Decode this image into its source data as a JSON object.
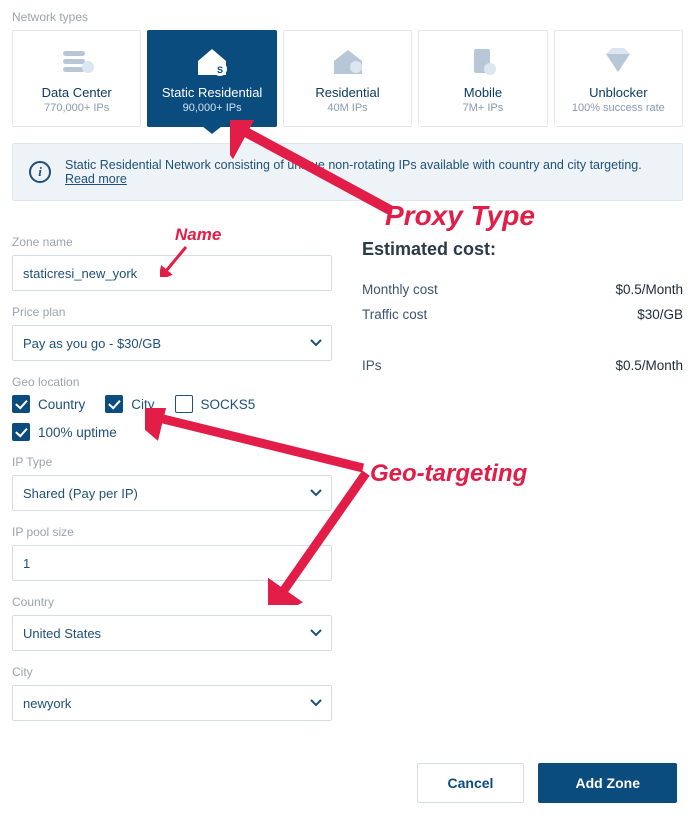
{
  "section_label": "Network types",
  "types": [
    {
      "title": "Data Center",
      "sub": "770,000+ IPs"
    },
    {
      "title": "Static Residential",
      "sub": "90,000+ IPs"
    },
    {
      "title": "Residential",
      "sub": "40M IPs"
    },
    {
      "title": "Mobile",
      "sub": "7M+ IPs"
    },
    {
      "title": "Unblocker",
      "sub": "100% success rate"
    }
  ],
  "info_text": "Static Residential Network consisting of unique non-rotating IPs available with country and city targeting.",
  "read_more": "Read more",
  "form": {
    "zone_name_label": "Zone name",
    "zone_name_value": "staticresi_new_york",
    "price_label": "Price plan",
    "price_value": "Pay as you go - $30/GB",
    "geo_label": "Geo location",
    "country_cb": "Country",
    "city_cb": "City",
    "socks5_cb": "SOCKS5",
    "uptime_cb": "100% uptime",
    "iptype_label": "IP Type",
    "iptype_value": "Shared (Pay per IP)",
    "pool_label": "IP pool size",
    "pool_value": "1",
    "country_label": "Country",
    "country_value": "United States",
    "city_label": "City",
    "city_value": "newyork"
  },
  "estimate": {
    "title": "Estimated cost:",
    "monthly_label": "Monthly cost",
    "monthly_value": "$0.5/Month",
    "traffic_label": "Traffic cost",
    "traffic_value": "$30/GB",
    "ips_label": "IPs",
    "ips_value": "$0.5/Month"
  },
  "buttons": {
    "cancel": "Cancel",
    "add": "Add Zone"
  },
  "annotations": {
    "name": "Name",
    "proxy": "Proxy Type",
    "geo": "Geo-targeting"
  }
}
